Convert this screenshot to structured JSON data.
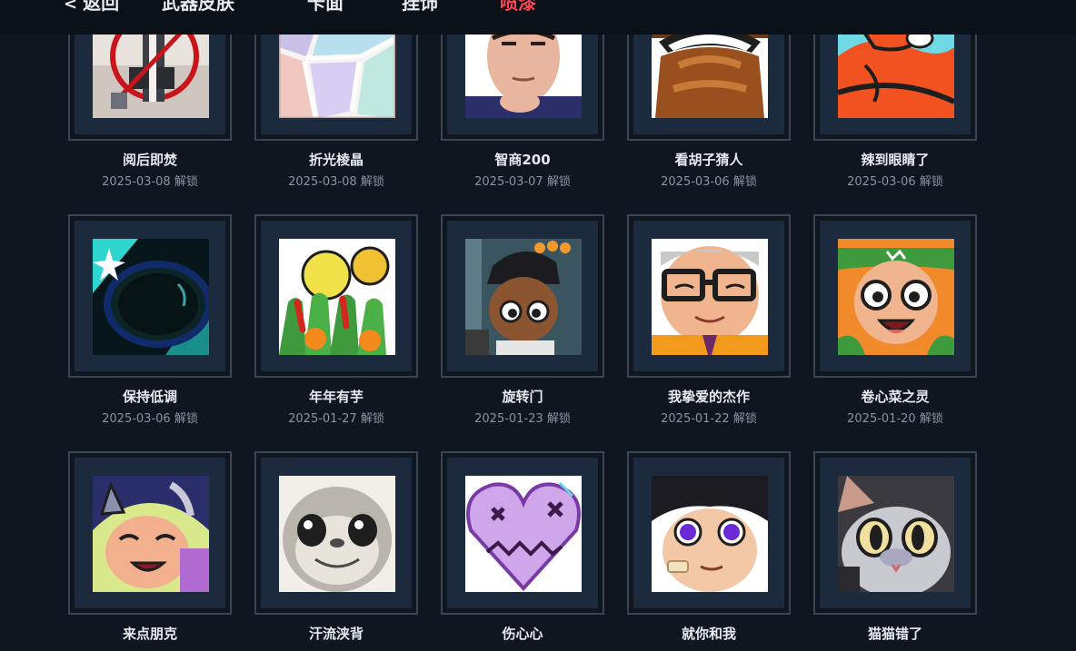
{
  "nav": {
    "back_label": "返回",
    "tabs": [
      {
        "label": "武器皮肤"
      },
      {
        "label": "卡面"
      },
      {
        "label": "挂饰"
      },
      {
        "label": "喷漆",
        "active": true
      }
    ],
    "active_color": "#ff4655"
  },
  "unlock_suffix": "解锁",
  "sprays": [
    {
      "name": "阅后即焚",
      "date": "2025-03-08",
      "status": "解锁",
      "icon": "burn-after-reading-spray-icon"
    },
    {
      "name": "折光棱晶",
      "date": "2025-03-08",
      "status": "解锁",
      "icon": "prism-spray-icon"
    },
    {
      "name": "智商200",
      "date": "2025-03-07",
      "status": "解锁",
      "icon": "iq200-spray-icon"
    },
    {
      "name": "看胡子猜人",
      "date": "2025-03-06",
      "status": "解锁",
      "icon": "beard-guess-spray-icon"
    },
    {
      "name": "辣到眼睛了",
      "date": "2025-03-06",
      "status": "解锁",
      "icon": "spicy-eyes-spray-icon"
    },
    {
      "name": "保持低调",
      "date": "2025-03-06",
      "status": "解锁",
      "icon": "low-profile-spray-icon"
    },
    {
      "name": "年年有芋",
      "date": "2025-01-27",
      "status": "解锁",
      "icon": "yearly-taro-spray-icon"
    },
    {
      "name": "旋转门",
      "date": "2025-01-23",
      "status": "解锁",
      "icon": "revolving-door-spray-icon"
    },
    {
      "name": "我挚爱的杰作",
      "date": "2025-01-22",
      "status": "解锁",
      "icon": "masterpiece-spray-icon"
    },
    {
      "name": "卷心菜之灵",
      "date": "2025-01-20",
      "status": "解锁",
      "icon": "cabbage-spirit-spray-icon"
    },
    {
      "name": "来点朋克",
      "date": "",
      "status": "",
      "icon": "punk-spray-icon"
    },
    {
      "name": "汗流浃背",
      "date": "",
      "status": "",
      "icon": "sweating-spray-icon"
    },
    {
      "name": "伤心心",
      "date": "",
      "status": "",
      "icon": "sad-heart-spray-icon"
    },
    {
      "name": "就你和我",
      "date": "",
      "status": "",
      "icon": "you-and-me-spray-icon"
    },
    {
      "name": "猫猫错了",
      "date": "",
      "status": "",
      "icon": "sorry-cat-spray-icon"
    }
  ]
}
